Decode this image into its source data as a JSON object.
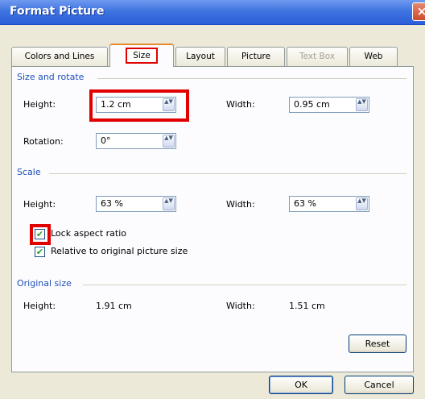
{
  "window": {
    "title": "Format Picture",
    "close_glyph": "×"
  },
  "tabs": [
    {
      "label": "Colors and Lines"
    },
    {
      "label": "Size"
    },
    {
      "label": "Layout"
    },
    {
      "label": "Picture"
    },
    {
      "label": "Text Box"
    },
    {
      "label": "Web"
    }
  ],
  "size_rotate": {
    "heading": "Size and rotate",
    "height_label": "Height:",
    "height_value": "1.2 cm",
    "width_label": "Width:",
    "width_value": "0.95 cm",
    "rotation_label": "Rotation:",
    "rotation_value": "0°"
  },
  "scale": {
    "heading": "Scale",
    "height_label": "Height:",
    "height_value": "63 %",
    "width_label": "Width:",
    "width_value": "63 %",
    "lock_aspect_label": "Lock aspect ratio",
    "lock_aspect_checked": true,
    "relative_label": "Relative to original picture size",
    "relative_checked": true
  },
  "original": {
    "heading": "Original size",
    "height_label": "Height:",
    "height_value": "1.91 cm",
    "width_label": "Width:",
    "width_value": "1.51 cm",
    "reset_label": "Reset"
  },
  "footer": {
    "ok_label": "OK",
    "cancel_label": "Cancel"
  },
  "icons": {
    "spin": "▲▼",
    "check": "✔"
  },
  "colors": {
    "highlight": "#e00000",
    "section_heading": "#1e4fb8",
    "check": "#21a121"
  }
}
